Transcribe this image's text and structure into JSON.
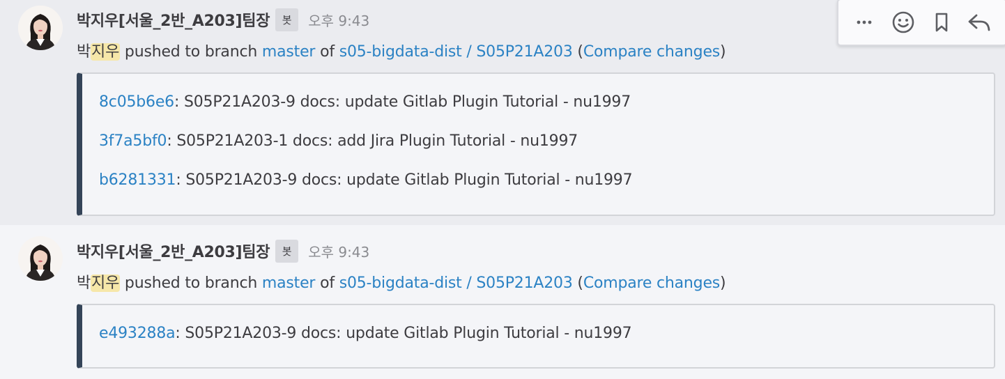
{
  "posts": [
    {
      "username": "박지우[서울_2반_A203]팀장",
      "bot_label": "봇",
      "time": "오후 9:43",
      "message": {
        "prefix": "박",
        "mention": "지우",
        "text1": " pushed to branch ",
        "branch": "master",
        "text2": " of ",
        "repo": "s05-bigdata-dist / S05P21A203",
        "text3": " (",
        "compare": "Compare changes",
        "text4": ")"
      },
      "commits": [
        {
          "hash": "8c05b6e6",
          "text": ": S05P21A203-9 docs: update Gitlab Plugin Tutorial - nu1997"
        },
        {
          "hash": "3f7a5bf0",
          "text": ": S05P21A203-1 docs: add Jira Plugin Tutorial - nu1997"
        },
        {
          "hash": "b6281331",
          "text": ": S05P21A203-9 docs: update Gitlab Plugin Tutorial - nu1997"
        }
      ]
    },
    {
      "username": "박지우[서울_2반_A203]팀장",
      "bot_label": "봇",
      "time": "오후 9:43",
      "message": {
        "prefix": "박",
        "mention": "지우",
        "text1": " pushed to branch ",
        "branch": "master",
        "text2": " of ",
        "repo": "s05-bigdata-dist / S05P21A203",
        "text3": " (",
        "compare": "Compare changes",
        "text4": ")"
      },
      "commits": [
        {
          "hash": "e493288a",
          "text": ": S05P21A203-9 docs: update Gitlab Plugin Tutorial - nu1997"
        }
      ]
    }
  ],
  "actions": {
    "icons": [
      "more-icon",
      "emoji-icon",
      "bookmark-icon",
      "reply-icon"
    ]
  },
  "colors": {
    "link": "#2b82c4",
    "mention_highlight": "#f6e7a9",
    "attachment_bar": "#344458",
    "hover_bg": "#ebecf0"
  }
}
